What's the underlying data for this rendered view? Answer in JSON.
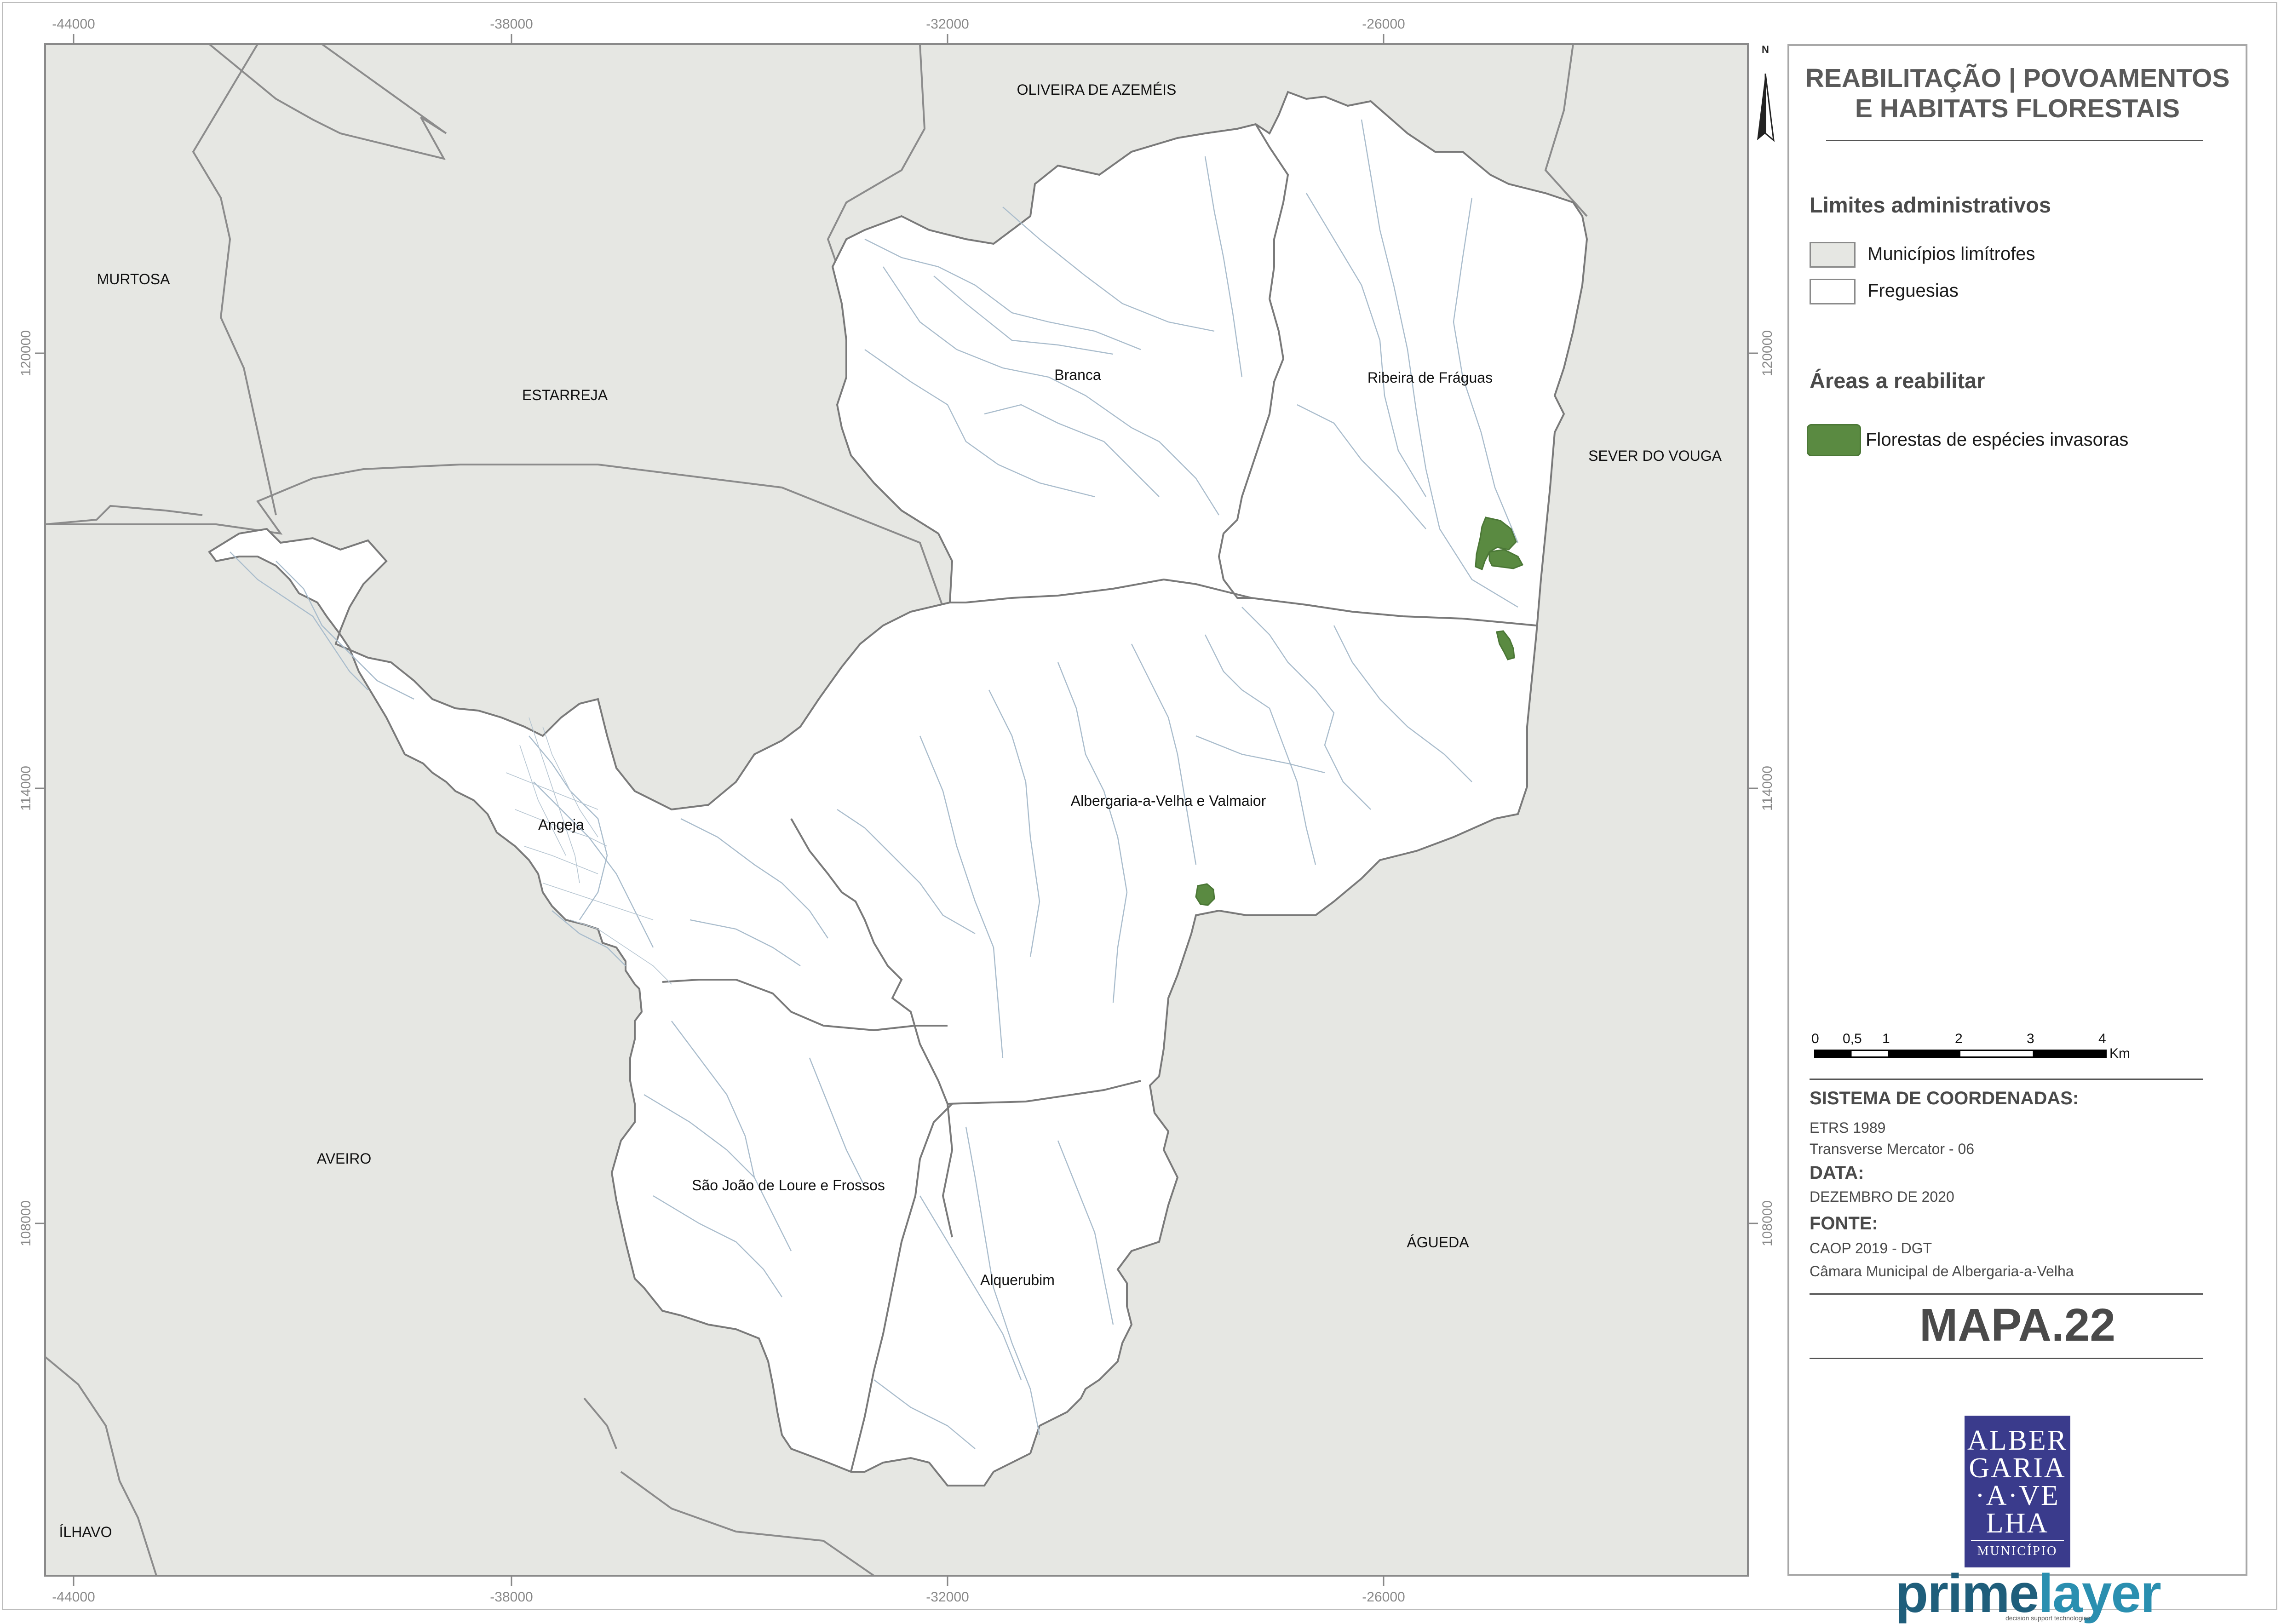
{
  "map": {
    "municipalities": [
      {
        "name": "OLIVEIRA DE AZEMÉIS"
      },
      {
        "name": "MURTOSA"
      },
      {
        "name": "ESTARREJA"
      },
      {
        "name": "SEVER DO VOUGA"
      },
      {
        "name": "AVEIRO"
      },
      {
        "name": "ÁGUEDA"
      },
      {
        "name": "ÍLHAVO"
      }
    ],
    "parishes": [
      {
        "name": "Branca"
      },
      {
        "name": "Ribeira de Fráguas"
      },
      {
        "name": "Angeja"
      },
      {
        "name": "Albergaria-a-Velha e Valmaior"
      },
      {
        "name": "São João de Loure e Frossos"
      },
      {
        "name": "Alquerubim"
      }
    ],
    "x_ticks": [
      "-44000",
      "-38000",
      "-32000",
      "-26000"
    ],
    "y_ticks": [
      "120000",
      "114000",
      "108000"
    ],
    "north_letter": "N",
    "colors": {
      "neighbour_fill": "#e6e7e3",
      "parish_fill": "#ffffff",
      "boundary": "#7a7a7a",
      "rivers": "#a9bccc",
      "invasive_forest": "#5a8a41"
    }
  },
  "panel": {
    "title_line1": "REABILITAÇÃO | POVOAMENTOS",
    "title_line2": "E HABITATS FLORESTAIS",
    "admin_heading": "Limites administrativos",
    "admin_items": [
      "Municípios limítrofes",
      "Freguesias"
    ],
    "rehab_heading": "Áreas a reabilitar",
    "rehab_items": [
      "Florestas de espécies invasoras"
    ],
    "scale_ticks": [
      "0",
      "0,5",
      "1",
      "2",
      "3",
      "4"
    ],
    "scale_unit": "Km",
    "coord_heading": "SISTEMA DE COORDENADAS:",
    "coord_lines": [
      "ETRS 1989",
      "Transverse Mercator - 06"
    ],
    "date_heading": "DATA:",
    "date_value": "DEZEMBRO DE 2020",
    "source_heading": "FONTE:",
    "source_lines": [
      "CAOP 2019 - DGT",
      "Câmara Municipal de Albergaria-a-Velha"
    ],
    "map_number": "MAPA.22",
    "logo_lines": [
      "ALBER",
      "GARIA",
      "·A·VE",
      "LHA"
    ],
    "logo_sub": "MUNICÍPIO",
    "brand_a": "prime",
    "brand_b": "layer",
    "brand_tagline": "decision support technologies"
  }
}
